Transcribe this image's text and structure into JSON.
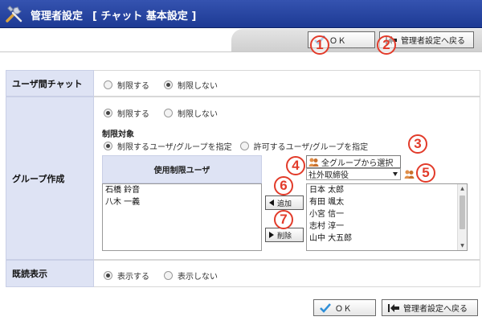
{
  "header": {
    "title": "管理者設定",
    "subtitle": "[ チャット 基本設定 ]",
    "icon": "tools-icon"
  },
  "toolbar": {
    "ok_label": "ＯＫ",
    "back_label": "管理者設定へ戻る"
  },
  "callouts": [
    "1",
    "2",
    "3",
    "4",
    "5",
    "6",
    "7"
  ],
  "rows": {
    "user_chat": {
      "label": "ユーザ間チャット",
      "options": [
        "制限する",
        "制限しない"
      ],
      "selected": 1
    },
    "group_create": {
      "label": "グループ作成",
      "options": [
        "制限する",
        "制限しない"
      ],
      "selected": 0,
      "target_heading": "制限対象",
      "target_options": [
        "制限するユーザ/グループを指定",
        "許可するユーザ/グループを指定"
      ],
      "target_selected": 0,
      "list_header": "使用制限ユーザ",
      "restricted_users": [
        "石橋 鈴音",
        "八木 一義"
      ],
      "group_select_label": "全グループから選択",
      "group_dropdown_value": "社外取締役",
      "add_label": "追加",
      "remove_label": "削除",
      "candidate_users": [
        "日本 太郎",
        "有田 颯太",
        "小宮 信一",
        "志村 淳一",
        "山中 大五郎"
      ]
    },
    "read_display": {
      "label": "既読表示",
      "options": [
        "表示する",
        "表示しない"
      ],
      "selected": 0
    }
  },
  "colors": {
    "header_bg": "#1d3a94",
    "label_bg": "#dee3f4",
    "callout": "#e23b2a",
    "ok_check": "#2f8fd8"
  }
}
